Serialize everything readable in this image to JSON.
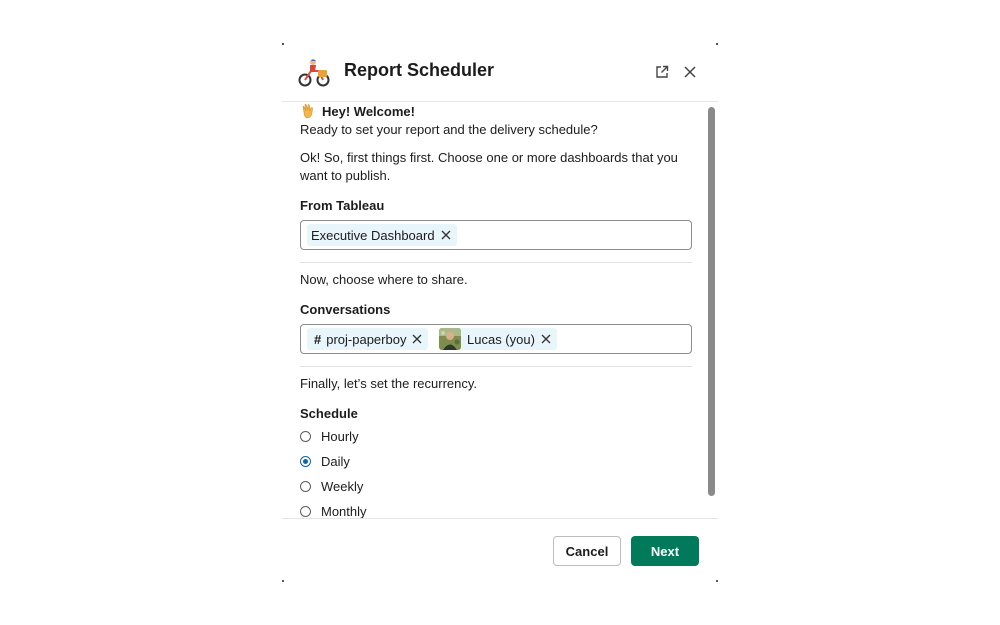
{
  "header": {
    "title": "Report Scheduler",
    "app_icon": "delivery-bike-icon",
    "open_external_icon": "external-link-icon",
    "close_icon": "close-icon"
  },
  "intro": {
    "welcome": "Hey! Welcome!",
    "welcome_icon": "waving-hand-icon",
    "subtitle": "Ready to set your report and the delivery schedule?",
    "instructions_line1": "Ok! So, first things first. Choose one or more dashboards that you",
    "instructions_line2": "want to publish."
  },
  "tableau": {
    "label": "From Tableau",
    "selected": [
      {
        "label": "Executive Dashboard",
        "remove_icon": "close-icon"
      }
    ]
  },
  "share": {
    "prompt": "Now, choose where to share.",
    "label": "Conversations",
    "selected": [
      {
        "prefix": "#",
        "label": "proj-paperboy",
        "remove_icon": "close-icon"
      },
      {
        "label": "Lucas (you)",
        "avatar": "user-avatar",
        "remove_icon": "close-icon"
      }
    ]
  },
  "schedule": {
    "prompt": "Finally, let’s set the recurrency.",
    "label": "Schedule",
    "options": [
      {
        "label": "Hourly",
        "selected": false
      },
      {
        "label": "Daily",
        "selected": true
      },
      {
        "label": "Weekly",
        "selected": false
      },
      {
        "label": "Monthly",
        "selected": false
      }
    ]
  },
  "footer": {
    "cancel_label": "Cancel",
    "next_label": "Next"
  },
  "colors": {
    "primary_button": "#007a5a",
    "chip_background": "#e8f5fa",
    "radio_selected": "#1264a3"
  }
}
